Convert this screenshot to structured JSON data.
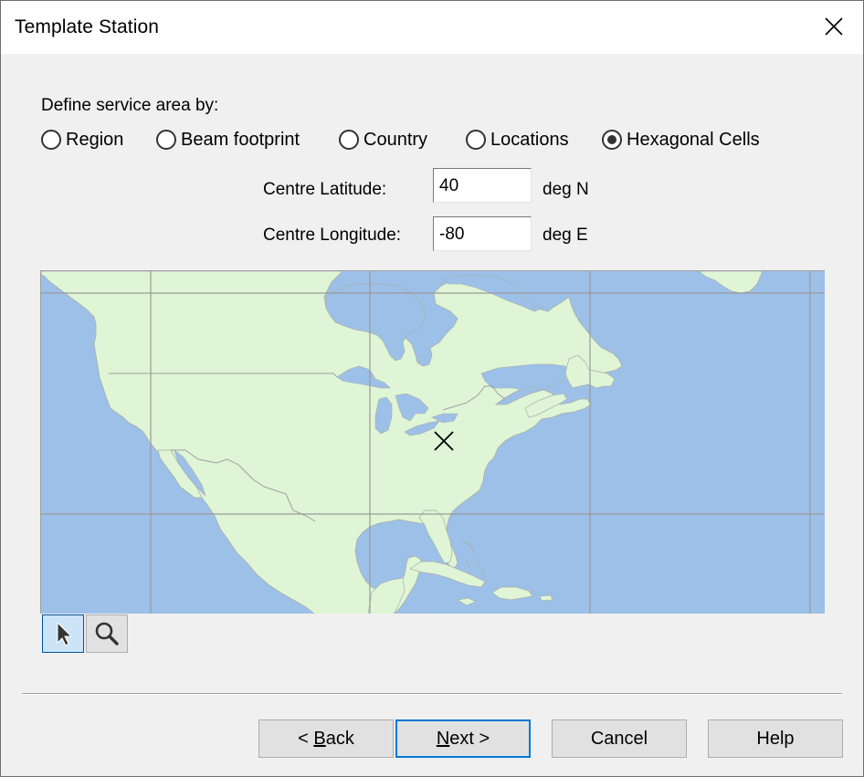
{
  "window": {
    "title": "Template Station",
    "close_icon": "close-icon"
  },
  "service_area": {
    "label": "Define service area by:",
    "options": [
      {
        "label": "Region",
        "checked": false
      },
      {
        "label": "Beam footprint",
        "checked": false
      },
      {
        "label": "Country",
        "checked": false
      },
      {
        "label": "Locations",
        "checked": false
      },
      {
        "label": "Hexagonal Cells",
        "checked": true
      }
    ]
  },
  "centre": {
    "latitude_label": "Centre Latitude:",
    "latitude_value": "40",
    "latitude_unit": "deg N",
    "longitude_label": "Centre Longitude:",
    "longitude_value": "-80",
    "longitude_unit": "deg E"
  },
  "map": {
    "description": "North America map with graticule; centre marker at 40N, 80W",
    "marker": {
      "lat": 40,
      "lon": -80,
      "icon": "cross-marker-icon"
    },
    "colors": {
      "land": "#dff5d6",
      "sea": "#9dc0e9",
      "grid": "#9a9a9a",
      "coast": "#a8b0a8"
    }
  },
  "map_tools": [
    {
      "name": "select-tool",
      "icon": "arrow-pointer-icon",
      "active": true
    },
    {
      "name": "zoom-tool",
      "icon": "magnifier-icon",
      "active": false
    }
  ],
  "buttons": {
    "back": {
      "prefix": "< ",
      "mnemonic": "B",
      "rest": "ack"
    },
    "next": {
      "prefix": "",
      "mnemonic": "N",
      "rest": "ext >"
    },
    "cancel": "Cancel",
    "help": "Help"
  },
  "colors": {
    "accent": "#0078d7",
    "tool_active_bg": "#cce4f7",
    "tool_active_border": "#005499"
  }
}
